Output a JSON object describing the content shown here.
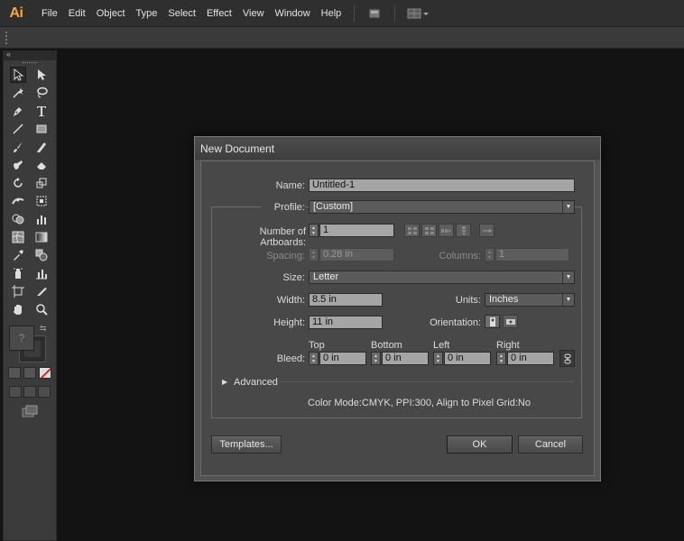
{
  "app": {
    "logo_text": "Ai",
    "accent": "#f2a93b"
  },
  "menu": [
    "File",
    "Edit",
    "Object",
    "Type",
    "Select",
    "Effect",
    "View",
    "Window",
    "Help"
  ],
  "tools_panel": {
    "collapse_glyph": "«",
    "fill_placeholder": "?"
  },
  "dialog": {
    "title": "New Document",
    "name_label": "Name:",
    "name_value": "Untitled-1",
    "profile_label": "Profile:",
    "profile_value": "[Custom]",
    "artboards_label": "Number of Artboards:",
    "artboards_value": "1",
    "spacing_label": "Spacing:",
    "spacing_value": "0.28 in",
    "columns_label": "Columns:",
    "columns_value": "1",
    "size_label": "Size:",
    "size_value": "Letter",
    "width_label": "Width:",
    "width_value": "8.5 in",
    "units_label": "Units:",
    "units_value": "Inches",
    "height_label": "Height:",
    "height_value": "11 in",
    "orientation_label": "Orientation:",
    "bleed_label": "Bleed:",
    "bleed_headers": {
      "top": "Top",
      "bottom": "Bottom",
      "left": "Left",
      "right": "Right"
    },
    "bleed_values": {
      "top": "0 in",
      "bottom": "0 in",
      "left": "0 in",
      "right": "0 in"
    },
    "advanced_label": "Advanced",
    "info_text": "Color Mode:CMYK, PPI:300, Align to Pixel Grid:No",
    "templates_button": "Templates...",
    "ok_button": "OK",
    "cancel_button": "Cancel"
  }
}
